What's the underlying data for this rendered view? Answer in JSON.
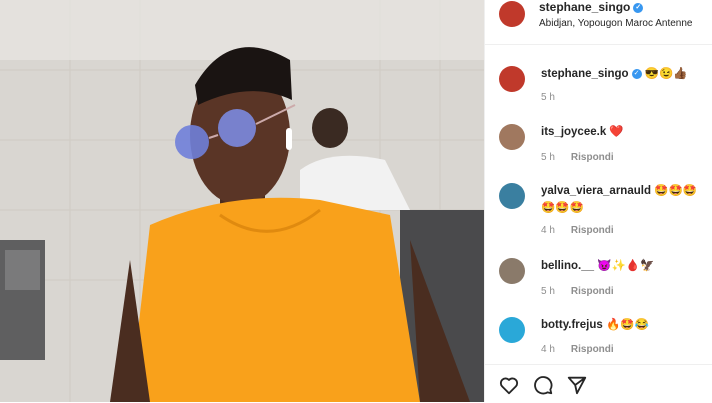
{
  "post": {
    "username": "stephane_singo",
    "location": "Abidjan, Yopougon Maroc Antenne",
    "verified_icon": "verified-badge-icon"
  },
  "comments": [
    {
      "username": "stephane_singo",
      "text": "😎😉👍🏾",
      "time": "5 h",
      "reply": ""
    },
    {
      "username": "its_joycee.k",
      "text": "❤️",
      "time": "5 h",
      "reply": "Rispondi"
    },
    {
      "username": "yalva_viera_arnauld",
      "text": "🤩🤩🤩🤩🤩🤩",
      "time": "4 h",
      "reply": "Rispondi"
    },
    {
      "username": "bellino.__",
      "text": "😈✨🩸🦅",
      "time": "5 h",
      "reply": "Rispondi"
    },
    {
      "username": "botty.frejus",
      "text": "🔥🤩😂",
      "time": "4 h",
      "reply": "Rispondi"
    }
  ],
  "actions": [
    "heart-icon",
    "comment-icon",
    "share-icon"
  ],
  "colors": {
    "accent": "#3897f0",
    "orange": "#f9a11b",
    "muted": "#8e8e8e",
    "heart": "#ed4956"
  }
}
